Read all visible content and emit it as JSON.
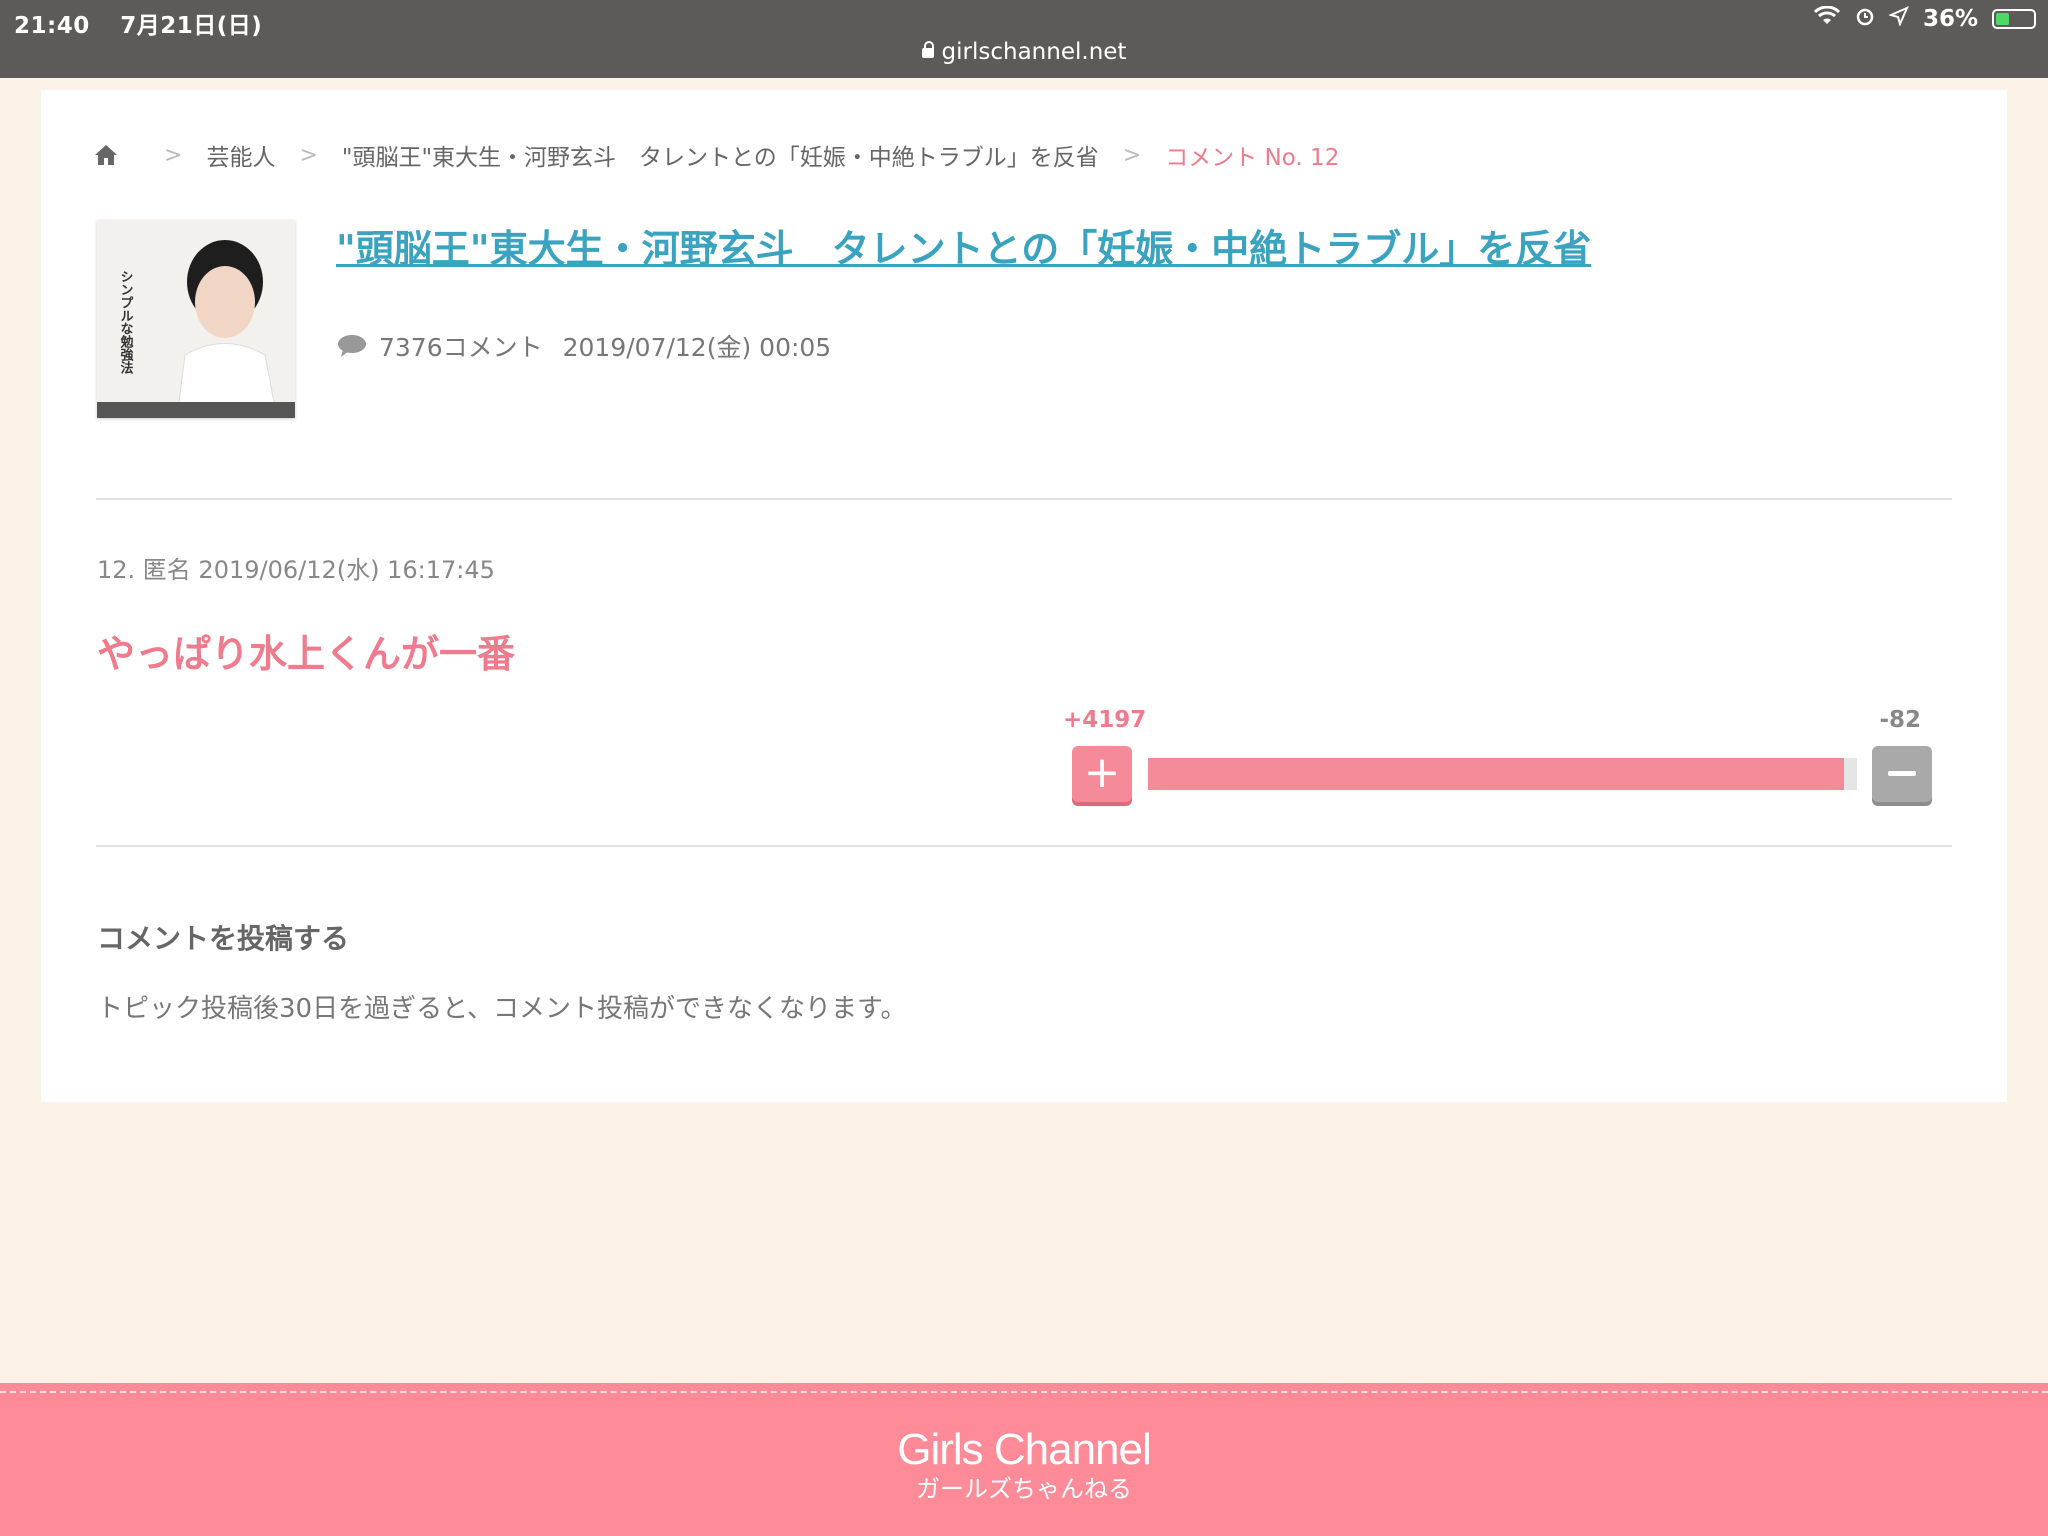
{
  "status_bar": {
    "time": "21:40",
    "date": "7月21日(日)",
    "battery": "36%",
    "battery_level": 0.36
  },
  "browser": {
    "url": "girlschannel.net"
  },
  "breadcrumb": {
    "items": [
      "芸能人",
      "\"頭脳王\"東大生・河野玄斗　タレントとの「妊娠・中絶トラブル」を反省"
    ],
    "current": "コメント No. 12"
  },
  "topic": {
    "title": "\"頭脳王\"東大生・河野玄斗　タレントとの「妊娠・中絶トラブル」を反省",
    "comments": "7376コメント",
    "date": "2019/07/12(金) 00:05",
    "thumb_text": "シンプルな勉強法"
  },
  "comment": {
    "meta": "12. 匿名 2019/06/12(水) 16:17:45",
    "body": "やっぱり水上くんが一番",
    "plus": "+4197",
    "minus": "-82",
    "plus_ratio": 0.981
  },
  "post": {
    "heading": "コメントを投稿する",
    "note": "トピック投稿後30日を過ぎると、コメント投稿ができなくなります。"
  },
  "footer": {
    "logo": "Girls Channel",
    "logo_sub": "ガールズちゃんねる"
  },
  "colors": {
    "accent": "#f07b8c",
    "link": "#3aa3c0",
    "footer": "#fe8b97"
  }
}
